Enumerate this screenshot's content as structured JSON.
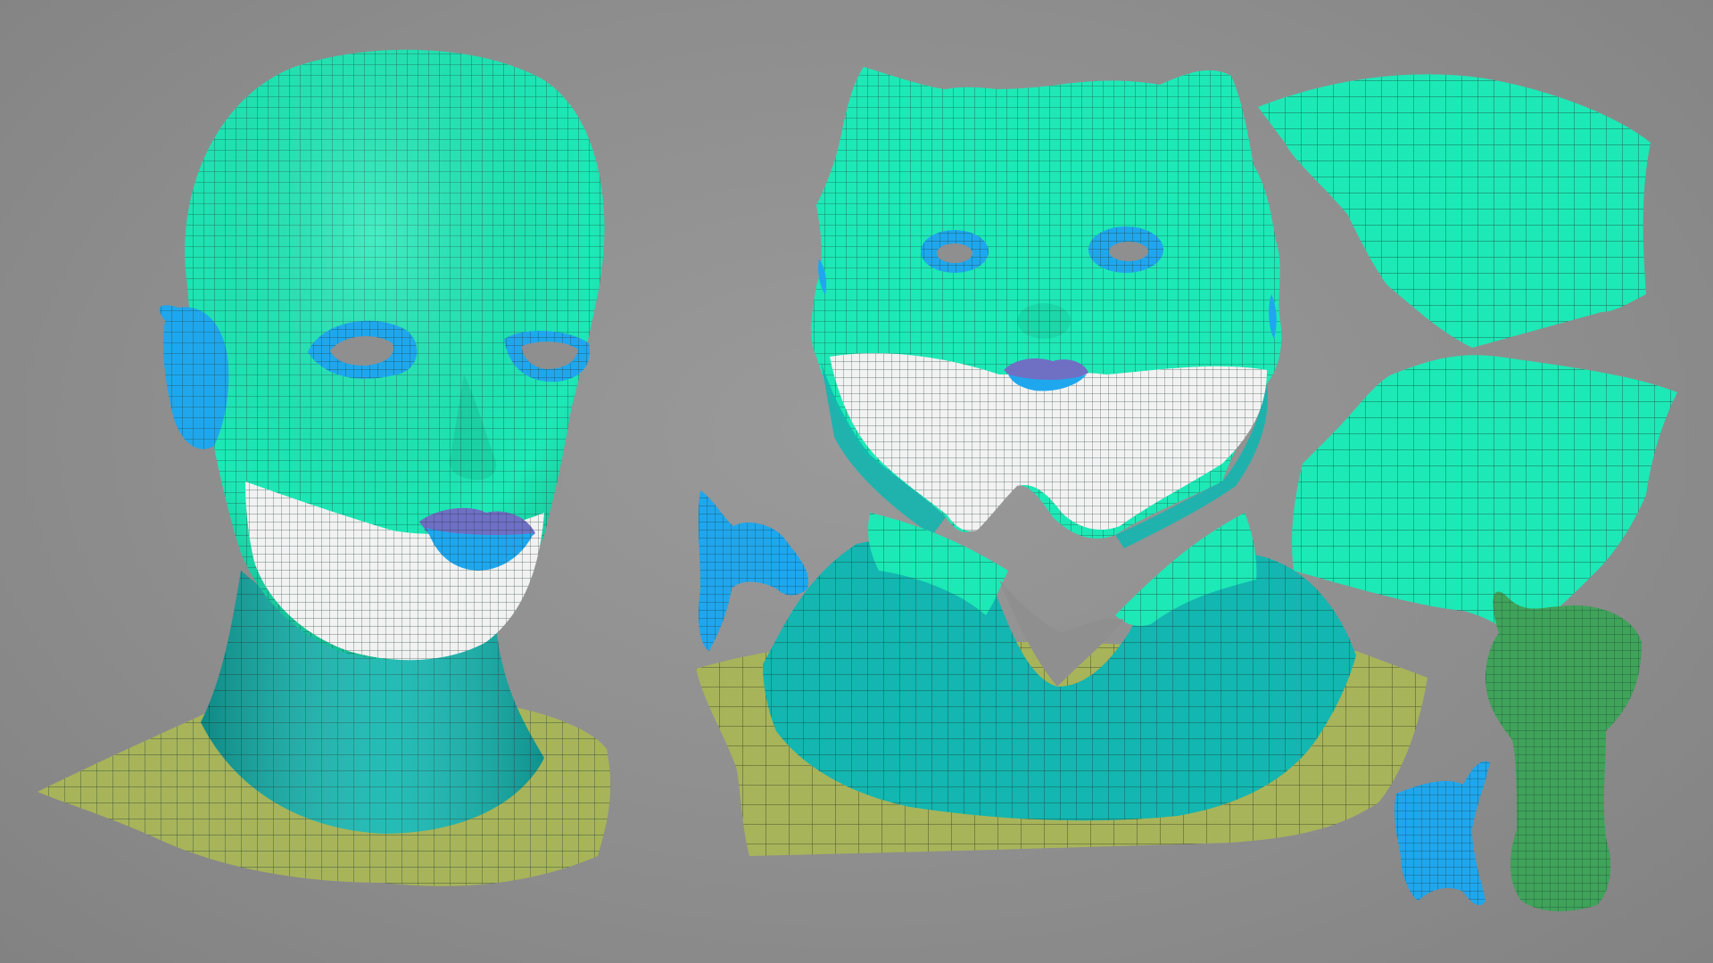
{
  "colors": {
    "background": "#8f8f8f",
    "face_mint": "#1de9b6",
    "face_mint_light": "#3ff5c8",
    "neck_teal": "#13b6b0",
    "chin_white": "#f2f2f2",
    "collar_olive": "#a8b45a",
    "ear_eye_blue": "#1fa7ee",
    "lips_blue": "#3b8ee0",
    "lips_purple": "#6f6fc4",
    "mouth_green": "#3fa35a",
    "wire": "#1b3a33"
  },
  "icons": {
    "head_model": "3d-head-mesh-icon",
    "uv_layout": "uv-islands-icon"
  }
}
